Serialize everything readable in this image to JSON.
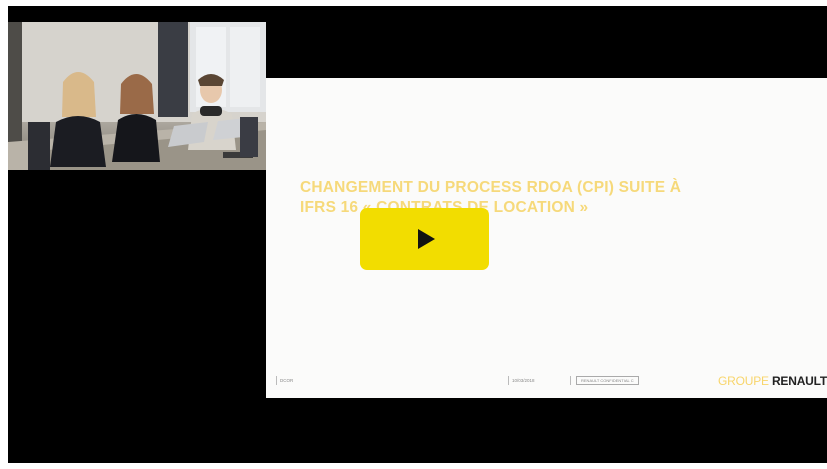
{
  "slide": {
    "title_line1": "CHANGEMENT DU PROCESS RDOA (CPI) SUITE À",
    "title_line2": "IFRS 16 « CONTRATS DE LOCATION »"
  },
  "footer": {
    "dept": "DCOR",
    "date": "10/03/2018",
    "confidentiality": "RENAULT CONFIDENTIAL C",
    "brand_prefix": "GROUPE",
    "brand_name": "RENAULT"
  },
  "colors": {
    "play_button": "#f2dd00",
    "title_text": "#f6d97a",
    "background": "#000000"
  },
  "icons": [
    "play-icon"
  ]
}
